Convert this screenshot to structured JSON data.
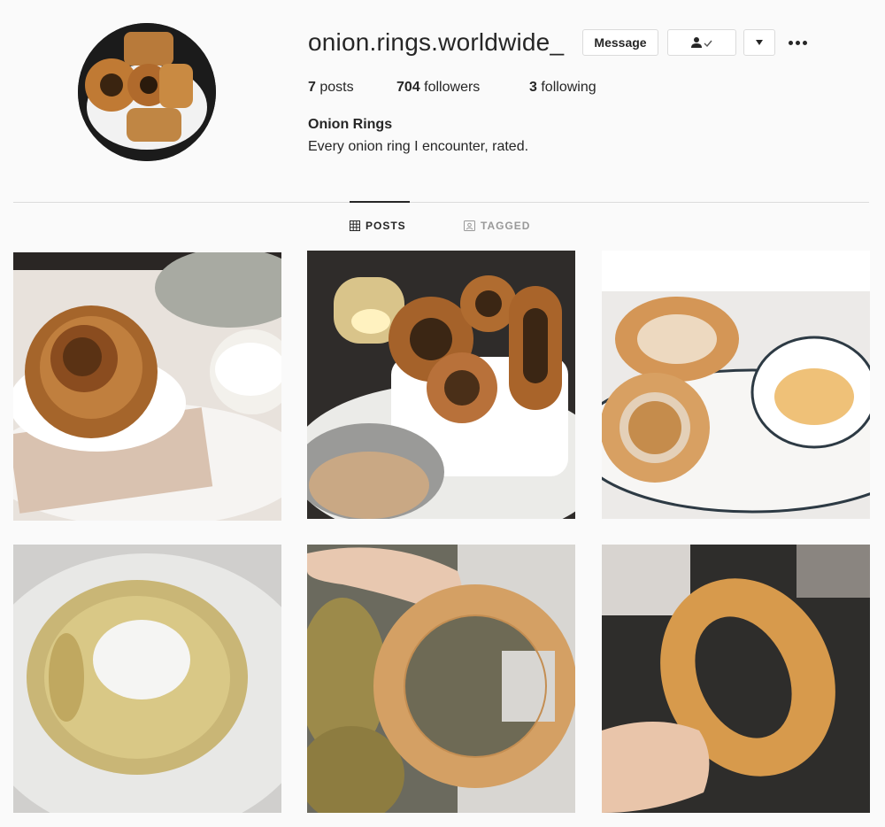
{
  "profile": {
    "username": "onion.rings.worldwide_",
    "full_name": "Onion Rings",
    "bio": "Every onion ring I encounter, rated.",
    "avatar_icon": "profile-photo"
  },
  "actions": {
    "message_label": "Message",
    "follow_icon": "person-check-icon",
    "dropdown_icon": "triangle-down-icon",
    "more_icon": "ellipsis-icon"
  },
  "stats": {
    "posts_count": "7",
    "posts_label": "posts",
    "followers_count": "704",
    "followers_label": "followers",
    "following_count": "3",
    "following_label": "following"
  },
  "tabs": [
    {
      "label": "POSTS",
      "icon": "grid-icon",
      "active": true
    },
    {
      "label": "TAGGED",
      "icon": "tag-portrait-icon",
      "active": false
    }
  ],
  "posts": [
    {
      "subject": "onion-rings-with-white-dip"
    },
    {
      "subject": "onion-rings-in-white-cup-candlelit"
    },
    {
      "subject": "onion-rings-with-orange-sauce"
    },
    {
      "subject": "battered-onion-ring-on-plate"
    },
    {
      "subject": "hand-holding-breaded-onion-ring"
    },
    {
      "subject": "hand-holding-golden-onion-ring"
    }
  ],
  "colors": {
    "background": "#fafafa",
    "text": "#262626",
    "border": "#dbdbdb",
    "muted": "#999999"
  }
}
